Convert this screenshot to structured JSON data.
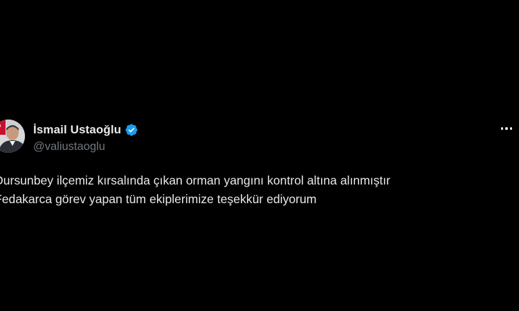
{
  "author": {
    "display_name": "İsmail Ustaoğlu",
    "handle": "@valiustaoglu",
    "verified_icon": "verified-badge-icon",
    "verified_color": "#1d9bf0"
  },
  "tweet": {
    "lines": [
      "Dursunbey ilçemiz kırsalında çıkan orman yangını kontrol altına alınmıştır",
      "Fedakarca görev yapan tüm ekiplerimize teşekkür ediyorum"
    ]
  },
  "menu": {
    "icon": "more-options-icon"
  },
  "colors": {
    "background": "#000000",
    "text_primary": "#e7e9ea",
    "text_secondary": "#71767b"
  }
}
